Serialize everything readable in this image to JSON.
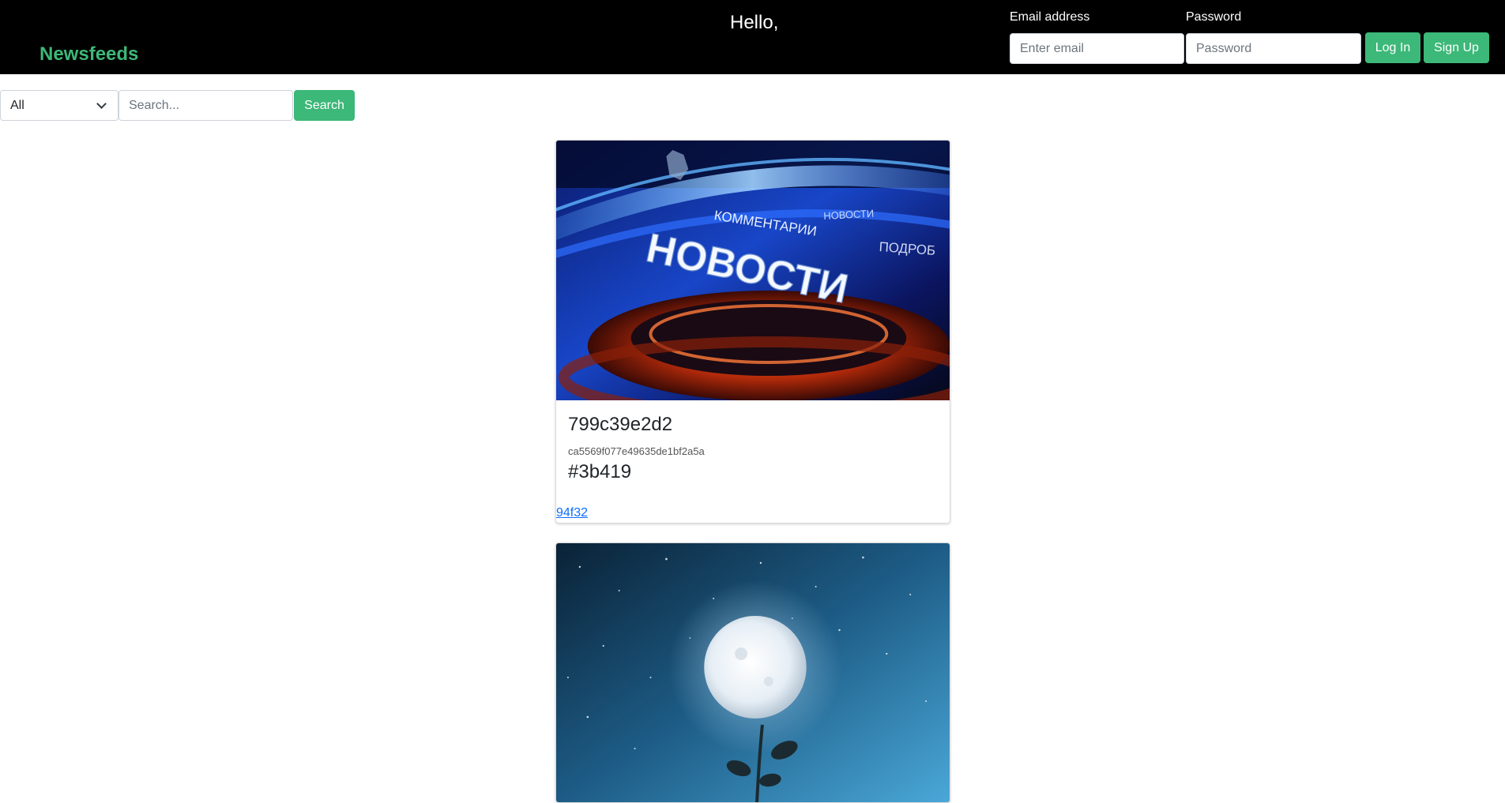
{
  "header": {
    "brand": "Newsfeeds",
    "greeting": "Hello,",
    "email_label": "Email address",
    "email_placeholder": "Enter email",
    "password_label": "Password",
    "password_placeholder": "Password",
    "login_label": "Log In",
    "signup_label": "Sign Up"
  },
  "filter": {
    "selected": "All",
    "search_placeholder": "Search...",
    "search_button": "Search"
  },
  "articles": [
    {
      "image_text": [
        "НОВОСТИ",
        "КОММЕНТАРИИ",
        "НОВОСТИ",
        "ПОДРОБ"
      ],
      "title": "799c39e2d2",
      "subtitle": "ca5569f077e49635de1bf2a5a",
      "tag": "#3b419",
      "link": "94f32"
    },
    {
      "image_text": []
    }
  ],
  "colors": {
    "accent": "#3cb878",
    "navbar": "#000000",
    "link": "#0d6efd"
  }
}
